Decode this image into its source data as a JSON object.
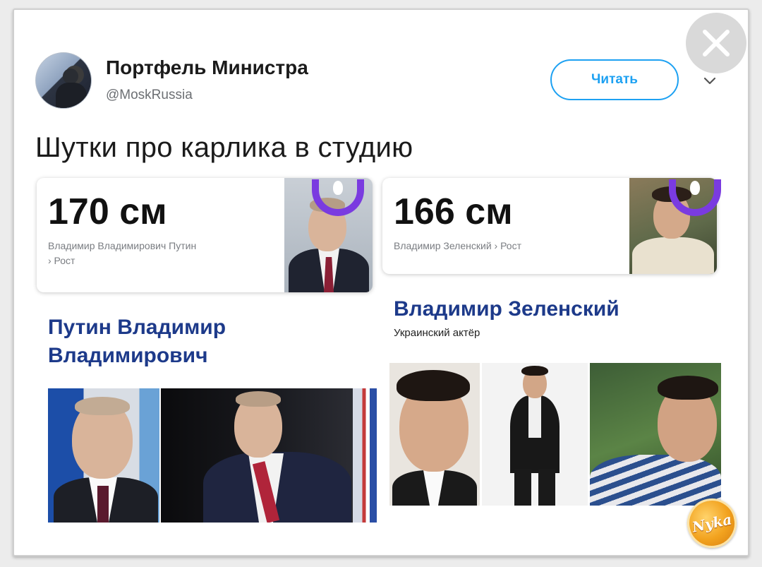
{
  "tweet": {
    "author_name": "Портфель Министра",
    "author_handle": "@MoskRussia",
    "follow_label": "Читать",
    "text": "Шутки про карлика в студию"
  },
  "cards": [
    {
      "height": "170 см",
      "caption_line1": "Владимир Владимирович Путин",
      "caption_line2": "› Рост",
      "person_name": "Путин Владимир Владимирович"
    },
    {
      "height": "166 см",
      "caption_line1": "Владимир Зеленский › Рост",
      "person_name": "Владимир Зеленский",
      "person_subtitle": "Украинский актёр"
    }
  ],
  "logo_text": "Nyka",
  "colors": {
    "twitter_blue": "#1da1f2",
    "name_blue": "#1d3a8a",
    "alice_purple": "#7a3be0"
  },
  "icons": {
    "close": "close-icon",
    "chevron": "chevron-down-icon",
    "voice_assistant": "purple-ring-icon"
  }
}
